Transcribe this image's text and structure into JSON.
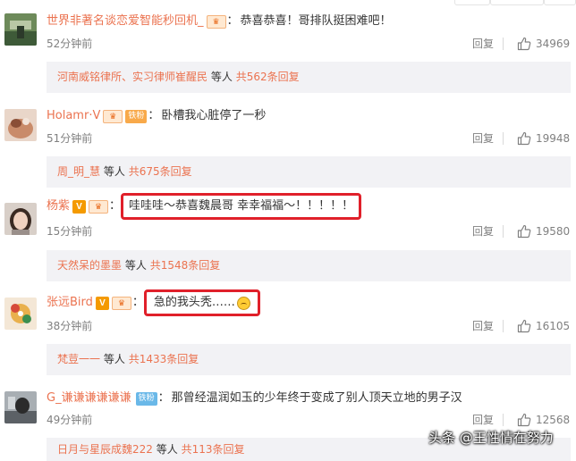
{
  "comments": [
    {
      "username": "世界非著名谈恋爱智能秒回机_",
      "badge": "",
      "fan_badge": "",
      "text": "恭喜恭喜！哥排队挺困难吧！",
      "time": "52分钟前",
      "reply_label": "回复",
      "likes": "34969",
      "replies_users": "河南威铭律所、实习律师崔醒民",
      "replies_mid": "等人",
      "replies_count": "共562条回复",
      "highlighted": false
    },
    {
      "username": "Holamr·V",
      "badge": "",
      "fan_badge": "铁粉",
      "text": "卧槽我心脏停了一秒",
      "time": "51分钟前",
      "reply_label": "回复",
      "likes": "19948",
      "replies_users": "周_明_慧",
      "replies_mid": "等人",
      "replies_count": "共675条回复",
      "highlighted": false
    },
    {
      "username": "杨紫",
      "badge": "V",
      "fan_badge": "",
      "text": "哇哇哇～恭喜魏晨哥 幸幸福福～！！！！！",
      "time": "15分钟前",
      "reply_label": "回复",
      "likes": "19580",
      "replies_users": "天然呆的墨墨",
      "replies_mid": "等人",
      "replies_count": "共1548条回复",
      "highlighted": true
    },
    {
      "username": "张远Bird",
      "badge": "V",
      "fan_badge": "",
      "text": "急的我头秃……",
      "time": "38分钟前",
      "reply_label": "回复",
      "likes": "16105",
      "replies_users": "梵荳一一",
      "replies_mid": "等人",
      "replies_count": "共1433条回复",
      "highlighted": true
    },
    {
      "username": "G_谦谦谦谦谦谦",
      "badge": "",
      "fan_badge": "铁粉",
      "text": "那曾经温润如玉的少年终于变成了别人顶天立地的男子汉",
      "time": "49分钟前",
      "reply_label": "回复",
      "likes": "12568",
      "replies_users": "日月与星辰成魏222",
      "replies_mid": "等人",
      "replies_count": "共113条回复",
      "highlighted": false
    }
  ],
  "watermark": "头条 @王性情在努力",
  "icons": {
    "like": "thumbs-up-icon",
    "vip": "crown-icon",
    "verified": "v-verified-icon",
    "emoji": "face-emoji-icon"
  },
  "colors": {
    "username": "#eb7350",
    "highlight_border": "#e0202a",
    "meta_gray": "#808080",
    "reply_box_bg": "#f2f2f5"
  }
}
